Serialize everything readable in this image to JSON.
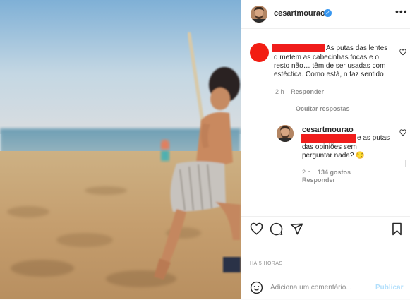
{
  "post": {
    "username": "cesartmourao",
    "verified_icon": "verified-badge-icon",
    "more_icon": "more-options-icon"
  },
  "comment": {
    "text": "As putas das lentes q metem as cabecinhas focas e o resto não… têm de ser usadas com estéctica. Como está, n faz sentido",
    "text_lines": [
      "As putas das lentes",
      "q metem as cabecinhas focas e o",
      "resto não… têm de ser usadas com",
      "estéctica. Como está, n faz sentido"
    ],
    "age": "2 h",
    "reply_label": "Responder",
    "hide_replies_label": "Ocultar respostas"
  },
  "reply": {
    "username": "cesartmourao",
    "text": "e as putas das opiniões sem perguntar nada? 😏",
    "text_lines": [
      "e as putas",
      "das opiniões sem",
      "perguntar nada? 😏"
    ],
    "age": "2 h",
    "likes": "134 gostos",
    "reply_label": "Responder"
  },
  "actions": {
    "like_icon": "heart-icon",
    "comment_icon": "comment-icon",
    "share_icon": "share-icon",
    "save_icon": "bookmark-icon"
  },
  "timestamp": "HÁ 5 HORAS",
  "add_comment": {
    "placeholder": "Adiciona um comentário...",
    "emoji_icon": "emoji-icon",
    "publish_label": "Publicar"
  }
}
